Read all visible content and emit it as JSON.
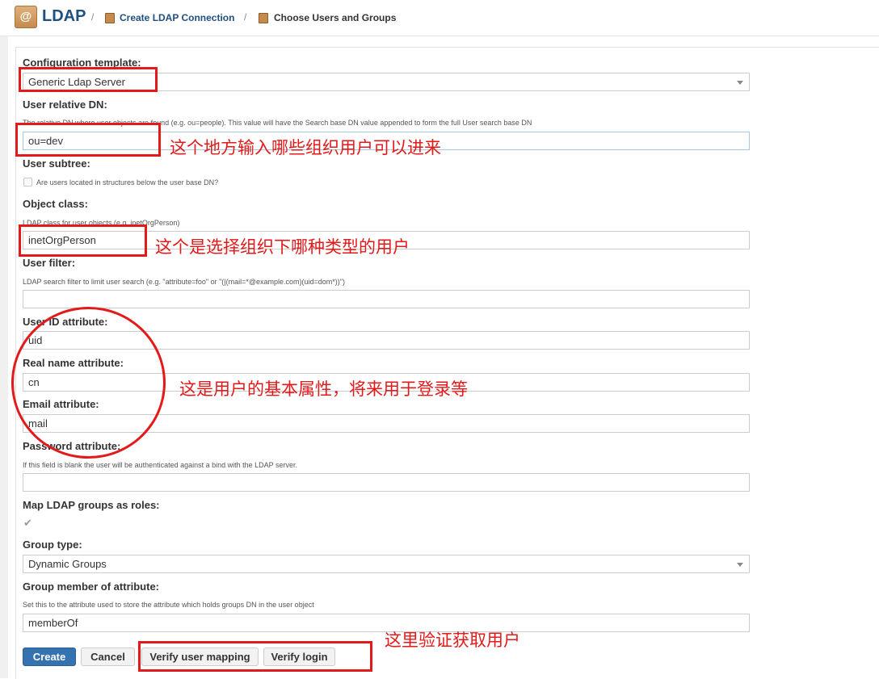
{
  "header": {
    "logo_glyph": "@",
    "app_name": "LDAP",
    "separator": "/",
    "crumb_link": "Create LDAP Connection",
    "crumb_current": "Choose Users and Groups"
  },
  "form": {
    "config_template": {
      "label": "Configuration template:",
      "value": "Generic Ldap Server"
    },
    "user_relative_dn": {
      "label": "User relative DN:",
      "description": "The relative DN where user objects are found (e.g. ou=people). This value will have the Search base DN value appended to form the full User search base DN",
      "value": "ou=dev"
    },
    "user_subtree": {
      "label": "User subtree:",
      "checkbox_label": "Are users located in structures below the user base DN?",
      "checked": false
    },
    "object_class": {
      "label": "Object class:",
      "description": "LDAP class for user objects (e.g. inetOrgPerson)",
      "value": "inetOrgPerson"
    },
    "user_filter": {
      "label": "User filter:",
      "description": "LDAP search filter to limit user search (e.g. \"attribute=foo\" or \"(|(mail=*@example.com)(uid=dom*))\")",
      "value": ""
    },
    "user_id_attribute": {
      "label": "User ID attribute:",
      "value": "uid"
    },
    "real_name_attribute": {
      "label": "Real name attribute:",
      "value": "cn"
    },
    "email_attribute": {
      "label": "Email attribute:",
      "value": "mail"
    },
    "password_attribute": {
      "label": "Password attribute:",
      "description": "If this field is blank the user will be authenticated against a bind with the LDAP server.",
      "value": ""
    },
    "map_groups": {
      "label": "Map LDAP groups as roles:",
      "checked": true,
      "check_glyph": "✔"
    },
    "group_type": {
      "label": "Group type:",
      "value": "Dynamic Groups"
    },
    "group_member_attribute": {
      "label": "Group member of attribute:",
      "description": "Set this to the attribute used to store the attribute which holds groups DN in the user object",
      "value": "memberOf"
    }
  },
  "buttons": {
    "create": "Create",
    "cancel": "Cancel",
    "verify_mapping": "Verify user mapping",
    "verify_login": "Verify login"
  },
  "annotations": {
    "note_dn": "这个地方输入哪些组织用户可以进来",
    "note_object_class": "这个是选择组织下哪种类型的用户",
    "note_attributes": "这是用户的基本属性，将来用于登录等",
    "note_verify": "这里验证获取用户",
    "color": "#e21a1a"
  },
  "colors": {
    "brand": "#205081",
    "primary_button": "#3572b0"
  }
}
